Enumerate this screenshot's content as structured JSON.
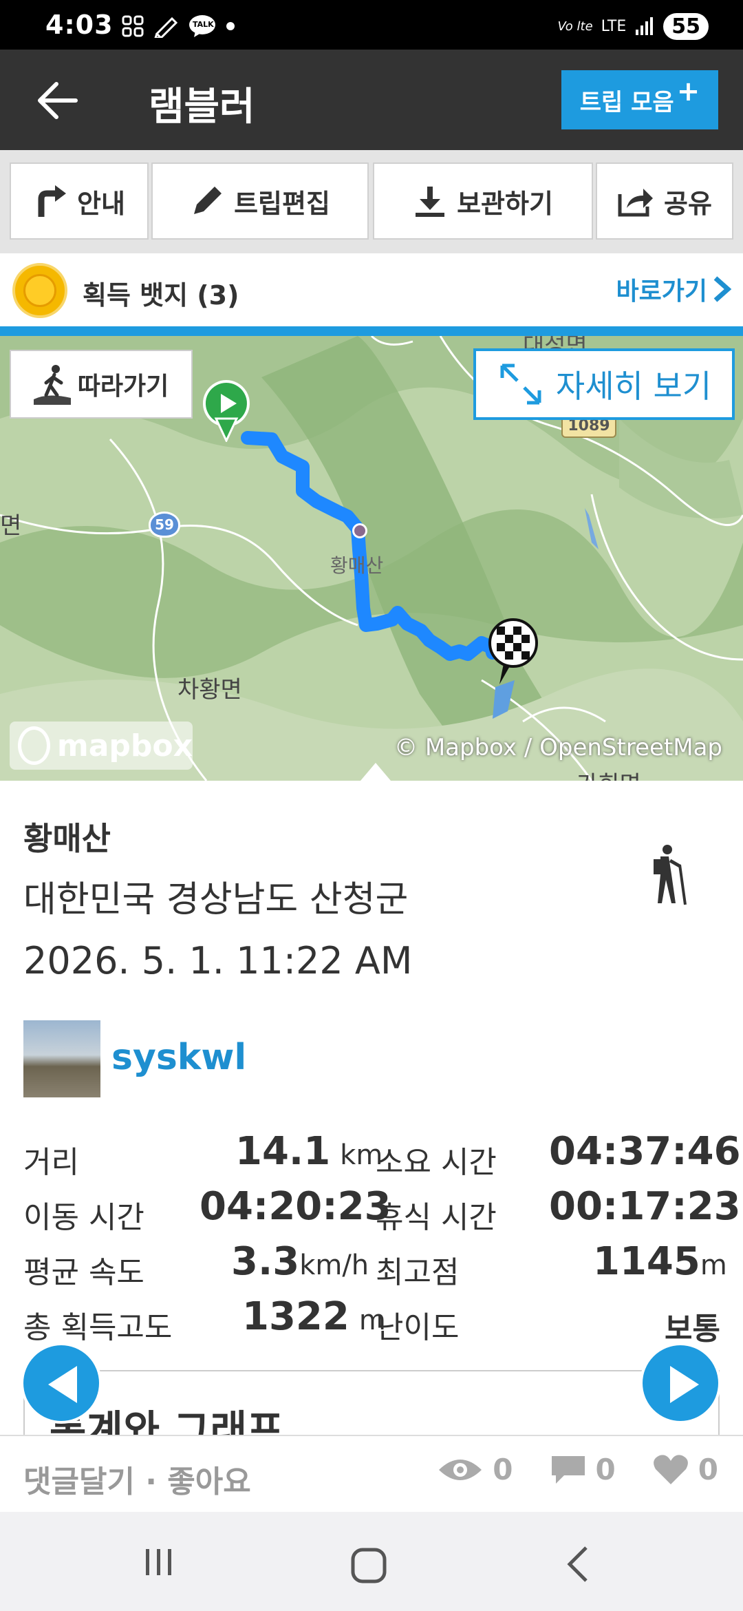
{
  "status_bar": {
    "time": "4:03",
    "notification_icons": [
      "grid-icon",
      "pen-icon",
      "talk-icon",
      "dot-icon"
    ],
    "talk_label": "TALK",
    "network_label": "LTE",
    "volte_label": "Vo lte",
    "battery_label": "55"
  },
  "app_bar": {
    "title": "램블러",
    "trips_button_label": "트립 모음",
    "trips_button_plus": "+"
  },
  "toolbar": {
    "guide_label": "안내",
    "edit_label": "트립편집",
    "save_label": "보관하기",
    "share_label": "공유"
  },
  "badges": {
    "label": "획득 뱃지 (3)",
    "goto_label": "바로가기"
  },
  "map": {
    "follow_label": "따라가기",
    "detail_label": "자세히 보기",
    "logo_label": "mapbox",
    "attribution": "© Mapbox / OpenStreetMap",
    "place_labels": {
      "top": "대성면",
      "peak": "황매산",
      "west": "차황면",
      "left_edge": "면",
      "bottom": "가회면"
    },
    "road_labels": {
      "route_59": "59",
      "route_1089": "1089"
    },
    "route_color": "#1e88ff"
  },
  "trip": {
    "title": "황매산",
    "address": "대한민국 경상남도 산청군",
    "datetime": "2026. 5. 1. 11:22 AM",
    "activity_icon": "hiking-icon",
    "username": "syskwl"
  },
  "stats": {
    "distance": {
      "label": "거리",
      "value": "14.1",
      "unit": "km"
    },
    "total_time": {
      "label": "소요 시간",
      "value": "04:37:46"
    },
    "moving_time": {
      "label": "이동 시간",
      "value": "04:20:23"
    },
    "rest_time": {
      "label": "휴식 시간",
      "value": "00:17:23"
    },
    "avg_speed": {
      "label": "평균 속도",
      "value": "3.3",
      "unit": "km/h"
    },
    "max_elevation": {
      "label": "최고점",
      "value": "1145",
      "unit": "m"
    },
    "total_ascent": {
      "label": "총 획득고도",
      "value": "1322",
      "unit": "m"
    },
    "difficulty": {
      "label": "난이도",
      "value": "보통"
    }
  },
  "section": {
    "label": "통계와 그래프"
  },
  "footer": {
    "comment_like_label": "댓글달기 · 좋아요",
    "views": "0",
    "comments": "0",
    "likes": "0"
  },
  "colors": {
    "accent": "#1e9bdf",
    "app_bar": "#333333",
    "route": "#1e88ff"
  }
}
